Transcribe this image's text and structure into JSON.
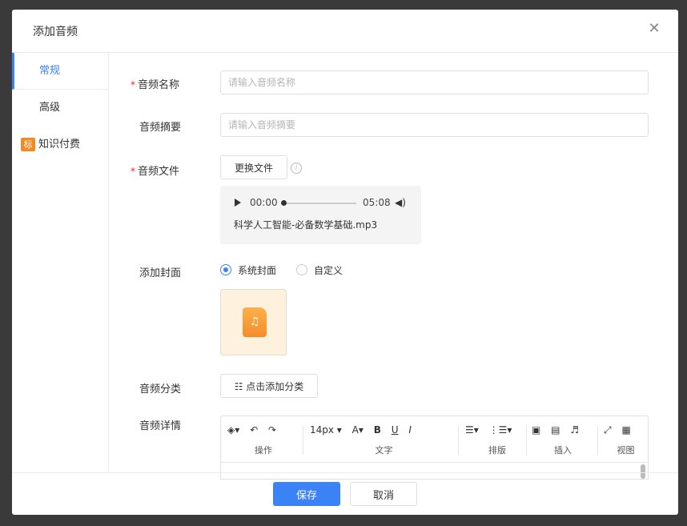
{
  "dialog": {
    "title": "添加音频",
    "close_glyph": "✕"
  },
  "nav": {
    "items": [
      {
        "label": "常规",
        "active": true
      },
      {
        "label": "高级",
        "active": false
      },
      {
        "label": "知识付费",
        "badge": "标",
        "active": false
      }
    ]
  },
  "form": {
    "name": {
      "label": "音频名称",
      "required_mark": "*",
      "placeholder": "请输入音频名称"
    },
    "summary": {
      "label": "音频摘要",
      "placeholder": "请输入音频摘要"
    },
    "file": {
      "label": "音频文件",
      "required_mark": "*",
      "replace_label": "更换文件",
      "info_glyph": "i",
      "player": {
        "current_time": "00:00",
        "total_time": "05:08",
        "progress": 0,
        "volume_glyph": "◀)",
        "file_name": "科学人工智能-必备数学基础.mp3"
      }
    },
    "cover": {
      "label": "添加封面",
      "options": [
        {
          "label": "系统封面",
          "checked": true
        },
        {
          "label": "自定义",
          "checked": false
        }
      ],
      "note_glyph": "♫"
    },
    "category": {
      "label": "音频分类",
      "button_label": "☷ 点击添加分类"
    },
    "detail": {
      "label": "音频详情",
      "toolbar": {
        "groups": [
          {
            "caption": "操作",
            "icons": [
              "◈▾",
              "↶",
              "↷"
            ]
          },
          {
            "caption": "文字",
            "icons": [
              "14px ▾",
              "A▾",
              "B",
              "U",
              "I"
            ]
          },
          {
            "caption": "排版",
            "icons": [
              "☰▾",
              "⋮☰▾"
            ]
          },
          {
            "caption": "插入",
            "icons": [
              "▣",
              "▤",
              "♬"
            ]
          },
          {
            "caption": "视图",
            "icons": [
              "⤢",
              "▦"
            ]
          }
        ]
      }
    }
  },
  "footer": {
    "save_label": "保存",
    "cancel_label": "取消"
  },
  "colors": {
    "accent": "#3b82f6",
    "required": "#f5222d",
    "badge": "#f08a24",
    "cover_bg": "#fef1de"
  }
}
